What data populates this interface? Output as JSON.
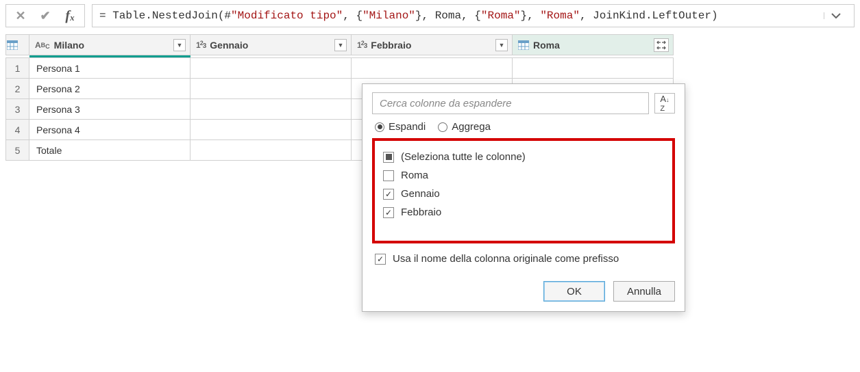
{
  "formula": {
    "prefix": "= Table.NestedJoin(#",
    "str1": "\"Modificato tipo\"",
    "mid1": ", {",
    "str2": "\"Milano\"",
    "mid2": "}, Roma, {",
    "str3": "\"Roma\"",
    "mid3": "}, ",
    "str4": "\"Roma\"",
    "suffix": ", JoinKind.LeftOuter)"
  },
  "columns": {
    "milano": "Milano",
    "gennaio": "Gennaio",
    "febbraio": "Febbraio",
    "roma": "Roma"
  },
  "rows": [
    "Persona 1",
    "Persona 2",
    "Persona 3",
    "Persona 4",
    "Totale"
  ],
  "rownums": [
    "1",
    "2",
    "3",
    "4",
    "5"
  ],
  "popup": {
    "search_placeholder": "Cerca colonne da espandere",
    "radio_expand": "Espandi",
    "radio_aggregate": "Aggrega",
    "select_all": "(Seleziona tutte le colonne)",
    "col_roma": "Roma",
    "col_gennaio": "Gennaio",
    "col_febbraio": "Febbraio",
    "prefix_label": "Usa il nome della colonna originale come prefisso",
    "ok": "OK",
    "cancel": "Annulla"
  }
}
